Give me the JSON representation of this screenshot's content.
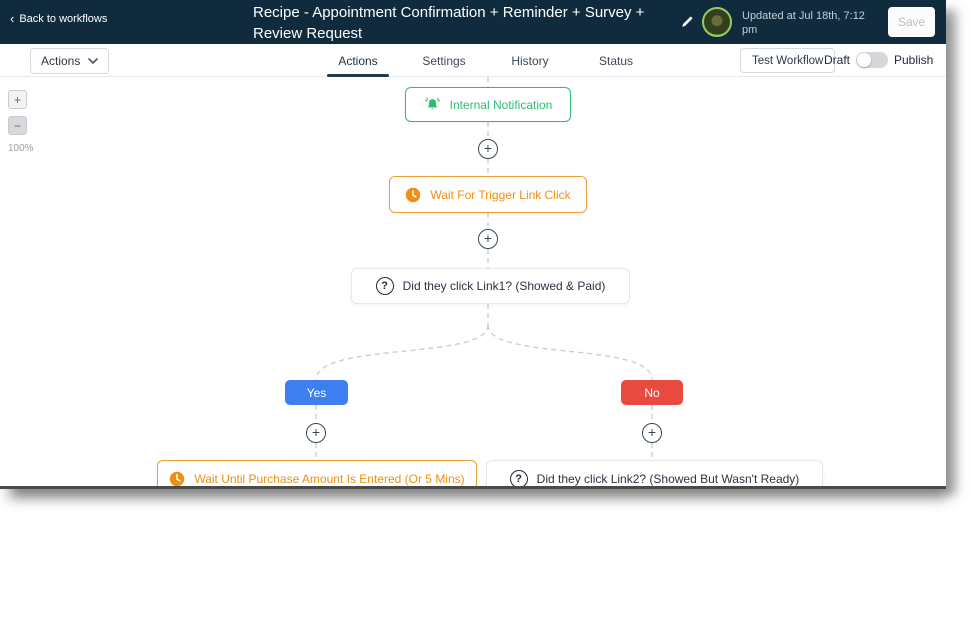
{
  "header": {
    "back_label": "Back to workflows",
    "back_chevron": "‹",
    "title": "Recipe - Appointment Confirmation + Reminder + Survey + Review Request",
    "updated_text": "Updated at Jul 18th, 7:12 pm",
    "save_label": "Save"
  },
  "toolbar": {
    "actions_dropdown_label": "Actions",
    "tabs": [
      {
        "label": "Actions",
        "active": true
      },
      {
        "label": "Settings",
        "active": false
      },
      {
        "label": "History",
        "active": false
      },
      {
        "label": "Status",
        "active": false
      }
    ],
    "test_workflow_label": "Test Workflow",
    "draft_label": "Draft",
    "publish_label": "Publish",
    "draft_toggle_state": "off"
  },
  "canvas": {
    "zoom_in_label": "+",
    "zoom_out_label": "−",
    "zoom_level": "100%",
    "nodes": {
      "internal_notification": {
        "label": "Internal Notification",
        "icon": "bell-icon",
        "color": "#2EBD72"
      },
      "wait_trigger": {
        "label": "Wait For Trigger Link Click",
        "icon": "clock-icon",
        "color": "#ED9013"
      },
      "condition_link1": {
        "label": "Did they click Link1? (Showed & Paid)",
        "icon": "question-icon"
      },
      "branch_yes": {
        "label": "Yes",
        "color": "#3D7FF0"
      },
      "branch_no": {
        "label": "No",
        "color": "#E84A3F"
      },
      "wait_purchase": {
        "label": "Wait Until Purchase Amount Is Entered (Or 5 Mins)",
        "icon": "clock-icon",
        "color": "#ED9013"
      },
      "condition_link2": {
        "label": "Did they click Link2? (Showed But Wasn't Ready)",
        "icon": "question-icon"
      }
    },
    "question_glyph": "?"
  },
  "colors": {
    "header_bg": "#0F2B3D",
    "green": "#2EBD72",
    "orange": "#ED9013",
    "blue": "#3D7FF0",
    "red": "#E84A3F",
    "plus_circle": "#33475C"
  }
}
